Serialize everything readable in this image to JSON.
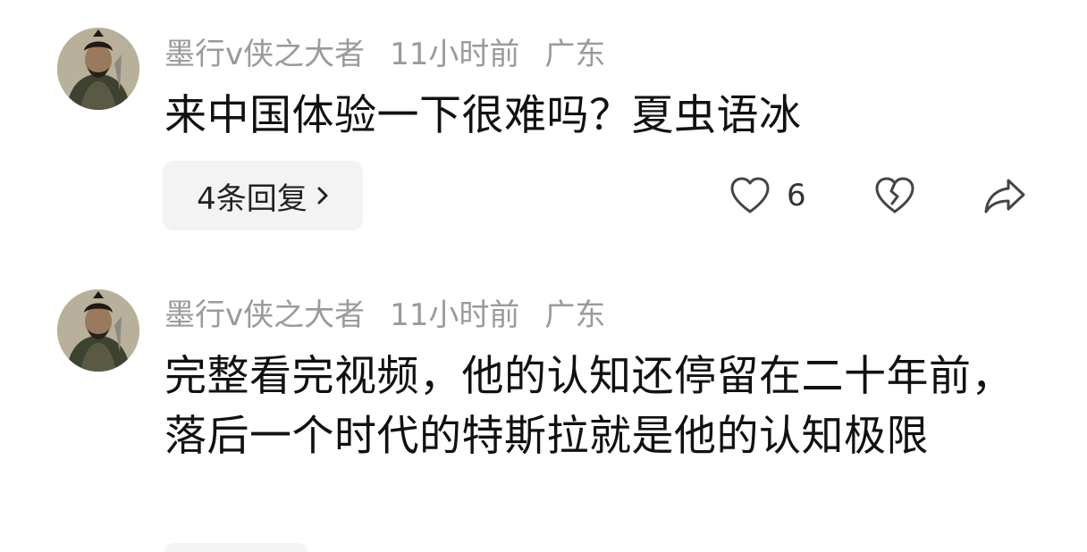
{
  "comments": [
    {
      "username": "墨行v侠之大者",
      "time": "11小时前",
      "location": "广东",
      "text": "来中国体验一下很难吗？夏虫语冰",
      "replies_label": "4条回复",
      "likes": "6"
    },
    {
      "username": "墨行v侠之大者",
      "time": "11小时前",
      "location": "广东",
      "text": "完整看完视频，他的认知还停留在二十年前，落后一个时代的特斯拉就是他的认知极限"
    }
  ],
  "icons": {
    "like": "heart-outline-icon",
    "dislike": "broken-heart-icon",
    "share": "share-arrow-icon",
    "replies_chevron": "chevron-right-icon"
  },
  "colors": {
    "meta_text": "#9a9a9a",
    "body_text": "#111111",
    "chip_bg": "#f3f3f3"
  }
}
